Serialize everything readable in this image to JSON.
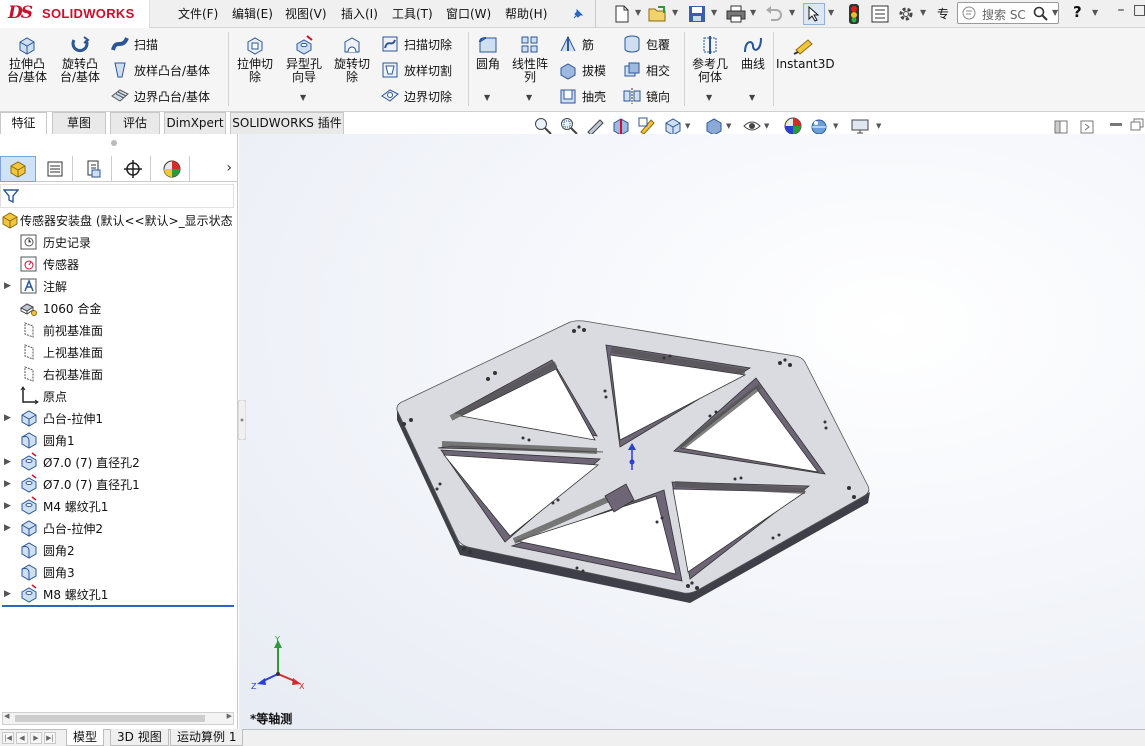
{
  "app": {
    "brand_ds": "DS",
    "brand_name": "SOLIDWORKS"
  },
  "menu": [
    "文件(F)",
    "编辑(E)",
    "视图(V)",
    "插入(I)",
    "工具(T)",
    "窗口(W)",
    "帮助(H)"
  ],
  "toolbar": {
    "search_placeholder": "搜索 SC",
    "more_label": "专",
    "help_label": "?"
  },
  "ribbon": {
    "extrude_boss": "拉伸凸台/基体",
    "revolve_boss": "旋转凸台/基体",
    "sweep": "扫描",
    "loft": "放样凸台/基体",
    "boundary": "边界凸台/基体",
    "extrude_cut": "拉伸切除",
    "hole_wizard": "异型孔向导",
    "revolve_cut": "旋转切除",
    "sweep_cut": "扫描切除",
    "loft_cut": "放样切割",
    "boundary_cut": "边界切除",
    "fillet": "圆角",
    "linear_pattern": "线性阵列",
    "rib": "筋",
    "draft": "拔模",
    "shell": "抽壳",
    "wrap": "包覆",
    "intersect": "相交",
    "mirror": "镜向",
    "ref_geometry": "参考几何体",
    "curves": "曲线",
    "instant3d": "Instant3D"
  },
  "command_tabs": [
    "特征",
    "草图",
    "评估",
    "DimXpert",
    "SOLIDWORKS 插件"
  ],
  "tree": {
    "root": "传感器安装盘 (默认<<默认>_显示状态",
    "items": [
      "历史记录",
      "传感器",
      "注解",
      "1060 合金",
      "前视基准面",
      "上视基准面",
      "右视基准面",
      "原点",
      "凸台-拉伸1",
      "圆角1",
      "Ø7.0 (7) 直径孔2",
      "Ø7.0 (7) 直径孔1",
      "M4 螺纹孔1",
      "凸台-拉伸2",
      "圆角2",
      "圆角3",
      "M8 螺纹孔1"
    ]
  },
  "viewport": {
    "view_name": "*等轴测",
    "axis_x": "X",
    "axis_y": "Y",
    "axis_z": "Z",
    "colors": {
      "part_face": "#d8d9dd",
      "part_side": "#444450",
      "cavity_wall": "#6e6577",
      "triad_x": "#d42b2b",
      "triad_y": "#2a9a3a",
      "triad_z": "#2a3fd4"
    }
  },
  "sheet_tabs": [
    "模型",
    "3D 视图",
    "运动算例 1"
  ],
  "colors": {
    "brand": "#c8102e",
    "selection": "#2a66c2"
  }
}
